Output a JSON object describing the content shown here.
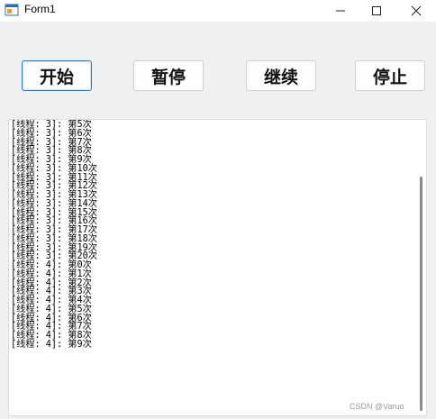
{
  "window": {
    "title": "Form1",
    "minimize_icon": "minimize-icon",
    "maximize_icon": "maximize-icon",
    "close_icon": "close-icon"
  },
  "toolbar": {
    "start_label": "开始",
    "pause_label": "暂停",
    "resume_label": "继续",
    "stop_label": "停止"
  },
  "log": {
    "lines": [
      "[线程: 3]: 第5次",
      "[线程: 3]: 第6次",
      "[线程: 3]: 第7次",
      "[线程: 3]: 第8次",
      "[线程: 3]: 第9次",
      "[线程: 3]: 第10次",
      "[线程: 3]: 第11次",
      "[线程: 3]: 第12次",
      "[线程: 3]: 第13次",
      "[线程: 3]: 第14次",
      "[线程: 3]: 第15次",
      "[线程: 3]: 第16次",
      "[线程: 3]: 第17次",
      "[线程: 3]: 第18次",
      "[线程: 3]: 第19次",
      "[线程: 3]: 第20次",
      "[线程: 4]: 第0次",
      "[线程: 4]: 第1次",
      "[线程: 4]: 第2次",
      "[线程: 4]: 第3次",
      "[线程: 4]: 第4次",
      "[线程: 4]: 第5次",
      "[线程: 4]: 第6次",
      "[线程: 4]: 第7次",
      "[线程: 4]: 第8次",
      "[线程: 4]: 第9次"
    ]
  },
  "watermark": "CSDN @Varuo"
}
